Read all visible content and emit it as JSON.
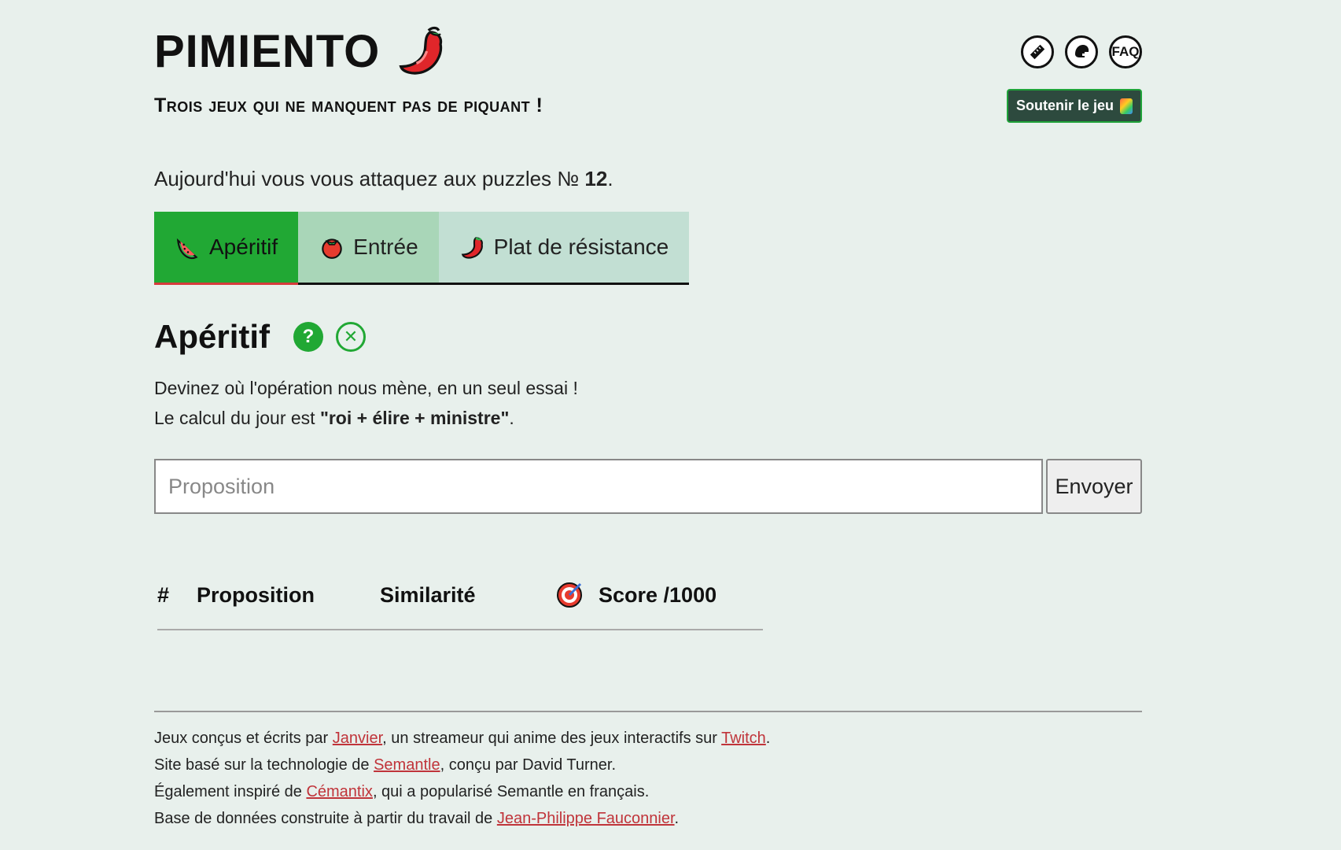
{
  "header": {
    "title": "PIMIENTO",
    "tagline": "Trois jeux qui ne manquent pas de piquant !",
    "icons": [
      "ruler-icon",
      "helmet-icon",
      "faq-icon"
    ],
    "faq_label": "FAQ",
    "support_label": "Soutenir le jeu"
  },
  "intro": {
    "prefix": "Aujourd'hui vous vous attaquez aux puzzles № ",
    "number": "12",
    "suffix": "."
  },
  "tabs": [
    {
      "label": "Apéritif",
      "icon": "watermelon-icon",
      "active": true
    },
    {
      "label": "Entrée",
      "icon": "tomato-icon",
      "active": false
    },
    {
      "label": "Plat de résistance",
      "icon": "pepper-icon",
      "active": false
    }
  ],
  "section": {
    "title": "Apéritif",
    "help_label": "?",
    "close_label": "✕",
    "line1": "Devinez où l'opération nous mène, en un seul essai !",
    "line2_prefix": "Le calcul du jour est ",
    "line2_bold": "\"roi + élire + ministre\"",
    "line2_suffix": "."
  },
  "form": {
    "placeholder": "Proposition",
    "value": "",
    "send_label": "Envoyer"
  },
  "table": {
    "col_hash": "#",
    "col_prop": "Proposition",
    "col_sim": "Similarité",
    "col_score": "Score /1000"
  },
  "footer": {
    "l1_a": "Jeux conçus et écrits par ",
    "l1_link1": "Janvier",
    "l1_b": ", un streameur qui anime des jeux interactifs sur ",
    "l1_link2": "Twitch",
    "l1_c": ".",
    "l2_a": "Site basé sur la technologie de ",
    "l2_link": "Semantle",
    "l2_b": ", conçu par David Turner.",
    "l3_a": "Également inspiré de ",
    "l3_link": "Cémantix",
    "l3_b": ", qui a popularisé Semantle en français.",
    "l4_a": "Base de données construite à partir du travail de ",
    "l4_link": "Jean-Philippe Fauconnier",
    "l4_b": "."
  },
  "colors": {
    "background": "#e8f0ec",
    "tab_active": "#21a834",
    "link": "#c0343a",
    "support_bg": "#2d4a3e"
  }
}
